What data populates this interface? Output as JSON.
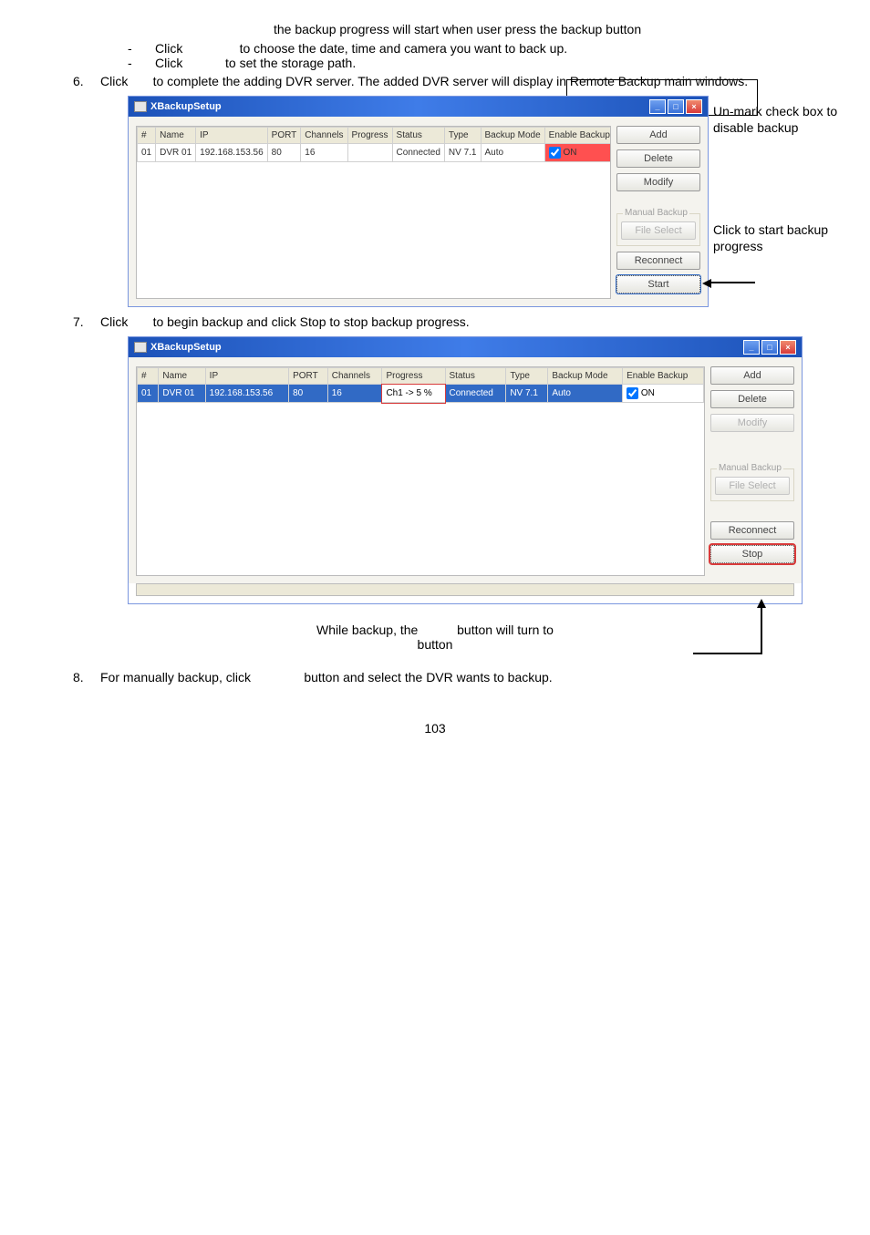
{
  "intro_line": "the backup progress will start when user press the backup button",
  "bullets": [
    {
      "pre": "Click",
      "post": "to choose the date, time and camera you want to back up."
    },
    {
      "pre": "Click",
      "post": "to set the storage path."
    }
  ],
  "step6": {
    "num": "6.",
    "pre": "Click",
    "post": "to complete the adding DVR server. The added DVR server will display in Remote Backup main windows."
  },
  "step7": {
    "num": "7.",
    "pre": "Click",
    "post": "to begin backup and click Stop to stop backup progress."
  },
  "step8": {
    "num": "8.",
    "pre": "For manually backup, click",
    "post": "button and select the DVR wants to backup."
  },
  "footer_note": {
    "a": "While backup, the",
    "b": "button will turn to",
    "c": "button"
  },
  "page_number": "103",
  "window_title": "XBackupSetup",
  "cols": [
    "#",
    "Name",
    "IP",
    "PORT",
    "Channels",
    "Progress",
    "Status",
    "Type",
    "Backup Mode",
    "Enable Backup"
  ],
  "row1_a": {
    "num": "01",
    "name": "DVR 01",
    "ip": "192.168.153.56",
    "port": "80",
    "ch": "16",
    "prog": "",
    "status": "Connected",
    "type": "NV 7.1",
    "mode": "Auto",
    "en": "ON"
  },
  "row1_b": {
    "num": "01",
    "name": "DVR 01",
    "ip": "192.168.153.56",
    "port": "80",
    "ch": "16",
    "prog": "Ch1 -> 5 %",
    "status": "Connected",
    "type": "NV 7.1",
    "mode": "Auto",
    "en": "ON"
  },
  "buttons": {
    "add": "Add",
    "delete": "Delete",
    "modify": "Modify",
    "manual_group": "Manual Backup",
    "file_select": "File Select",
    "reconnect": "Reconnect",
    "start": "Start",
    "stop": "Stop"
  },
  "annot": {
    "unmark": "Un-mark check box to disable backup",
    "click_start": "Click to start backup progress"
  }
}
